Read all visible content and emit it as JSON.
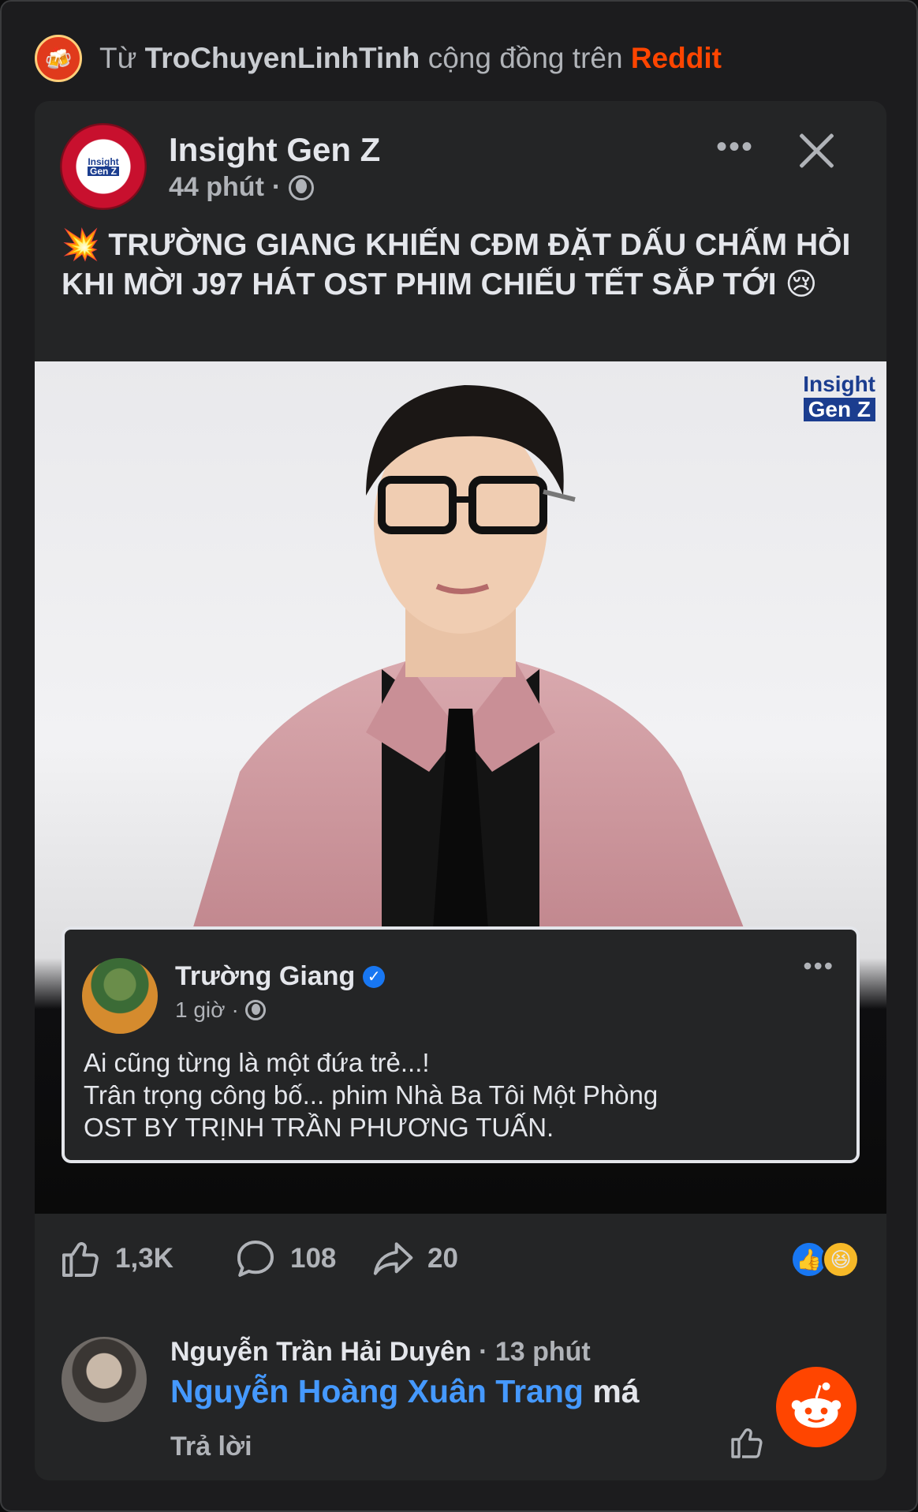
{
  "source": {
    "prefix": "Từ",
    "subreddit": "TroChuyenLinhTinh",
    "middle": "cộng đồng trên",
    "platform": "Reddit"
  },
  "post": {
    "page_name": "Insight Gen Z",
    "time": "44 phút",
    "separator": "·",
    "headline_emoji_start": "💥",
    "headline": "TRƯỜNG GIANG KHIẾN CĐM ĐẶT DẤU CHẤM HỎI KHI MỜI J97 HÁT OST PHIM CHIẾU TẾT SẮP TỚI",
    "headline_emoji_end": "😢",
    "more": "•••",
    "watermark_line1": "Insight",
    "watermark_line2": "Gen Z",
    "avatar_line1": "Insight",
    "avatar_line2": "Gen Z"
  },
  "quoted_post": {
    "author": "Trường Giang",
    "verified_mark": "✓",
    "time": "1 giờ",
    "separator": "·",
    "more": "•••",
    "line1": "Ai cũng từng là một đứa trẻ...!",
    "line2": "Trân trọng công bố... phim Nhà Ba Tôi Một Phòng",
    "line3": "OST BY TRỊNH TRẦN PHƯƠNG TUẤN."
  },
  "actions": {
    "likes": "1,3K",
    "comments": "108",
    "shares": "20",
    "reaction_like": "👍",
    "reaction_haha": "😆"
  },
  "comment": {
    "author": "Nguyễn Trần Hải Duyên",
    "time": "· 13 phút",
    "mention": "Nguyễn Hoàng Xuân Trang",
    "text": "má",
    "reply": "Trả lời"
  },
  "colors": {
    "reddit_orange": "#ff4500",
    "mention_blue": "#4599ff",
    "card_bg": "#242526"
  }
}
